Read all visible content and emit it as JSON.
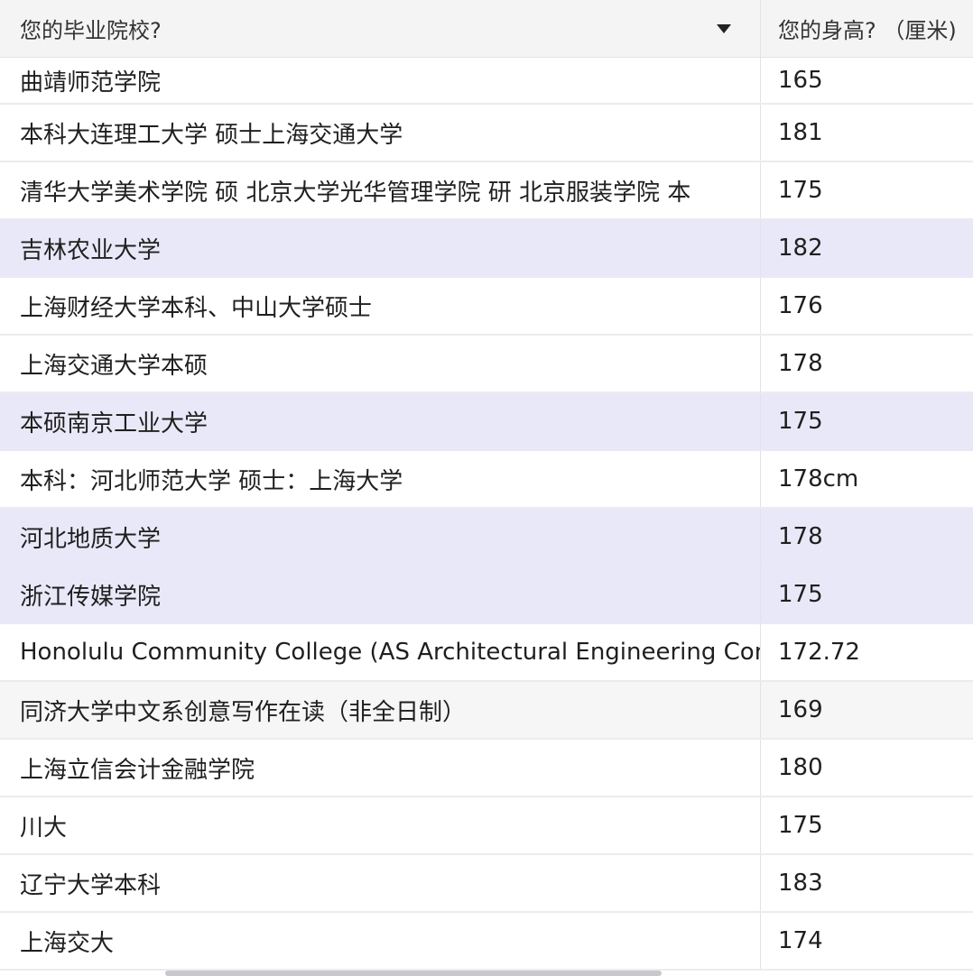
{
  "table": {
    "columns": [
      {
        "label": "您的毕业院校?"
      },
      {
        "label": "您的身高? （厘米)"
      }
    ],
    "rows": [
      {
        "school": "曲靖师范学院",
        "height": "165",
        "style": "first"
      },
      {
        "school": "本科大连理工大学 硕士上海交通大学",
        "height": "181",
        "style": ""
      },
      {
        "school": "清华大学美术学院 硕 北京大学光华管理学院 研 北京服装学院 本",
        "height": "175",
        "style": ""
      },
      {
        "school": "吉林农业大学",
        "height": "182",
        "style": "highlight"
      },
      {
        "school": "上海财经大学本科、中山大学硕士",
        "height": "176",
        "style": ""
      },
      {
        "school": "上海交通大学本硕",
        "height": "178",
        "style": ""
      },
      {
        "school": "本硕南京工业大学",
        "height": "175",
        "style": "highlight"
      },
      {
        "school": "本科：河北师范大学 硕士：上海大学",
        "height": "178cm",
        "style": ""
      },
      {
        "school": "河北地质大学",
        "height": "178",
        "style": "highlight"
      },
      {
        "school": "浙江传媒学院",
        "height": "175",
        "style": "highlight"
      },
      {
        "school": "Honolulu Community College (AS Architectural Engineering Con",
        "height": "172.72",
        "style": ""
      },
      {
        "school": "同济大学中文系创意写作在读（非全日制）",
        "height": "169",
        "style": "grey"
      },
      {
        "school": "上海立信会计金融学院",
        "height": "180",
        "style": ""
      },
      {
        "school": "川大",
        "height": "175",
        "style": ""
      },
      {
        "school": "辽宁大学本科",
        "height": "183",
        "style": ""
      },
      {
        "school": "上海交大",
        "height": "174",
        "style": ""
      }
    ]
  },
  "colors": {
    "highlight": "#e9e8f8",
    "header_bg": "#f4f4f5",
    "grid": "#ececee"
  },
  "icons": {
    "dropdown": "chevron-down-icon"
  }
}
